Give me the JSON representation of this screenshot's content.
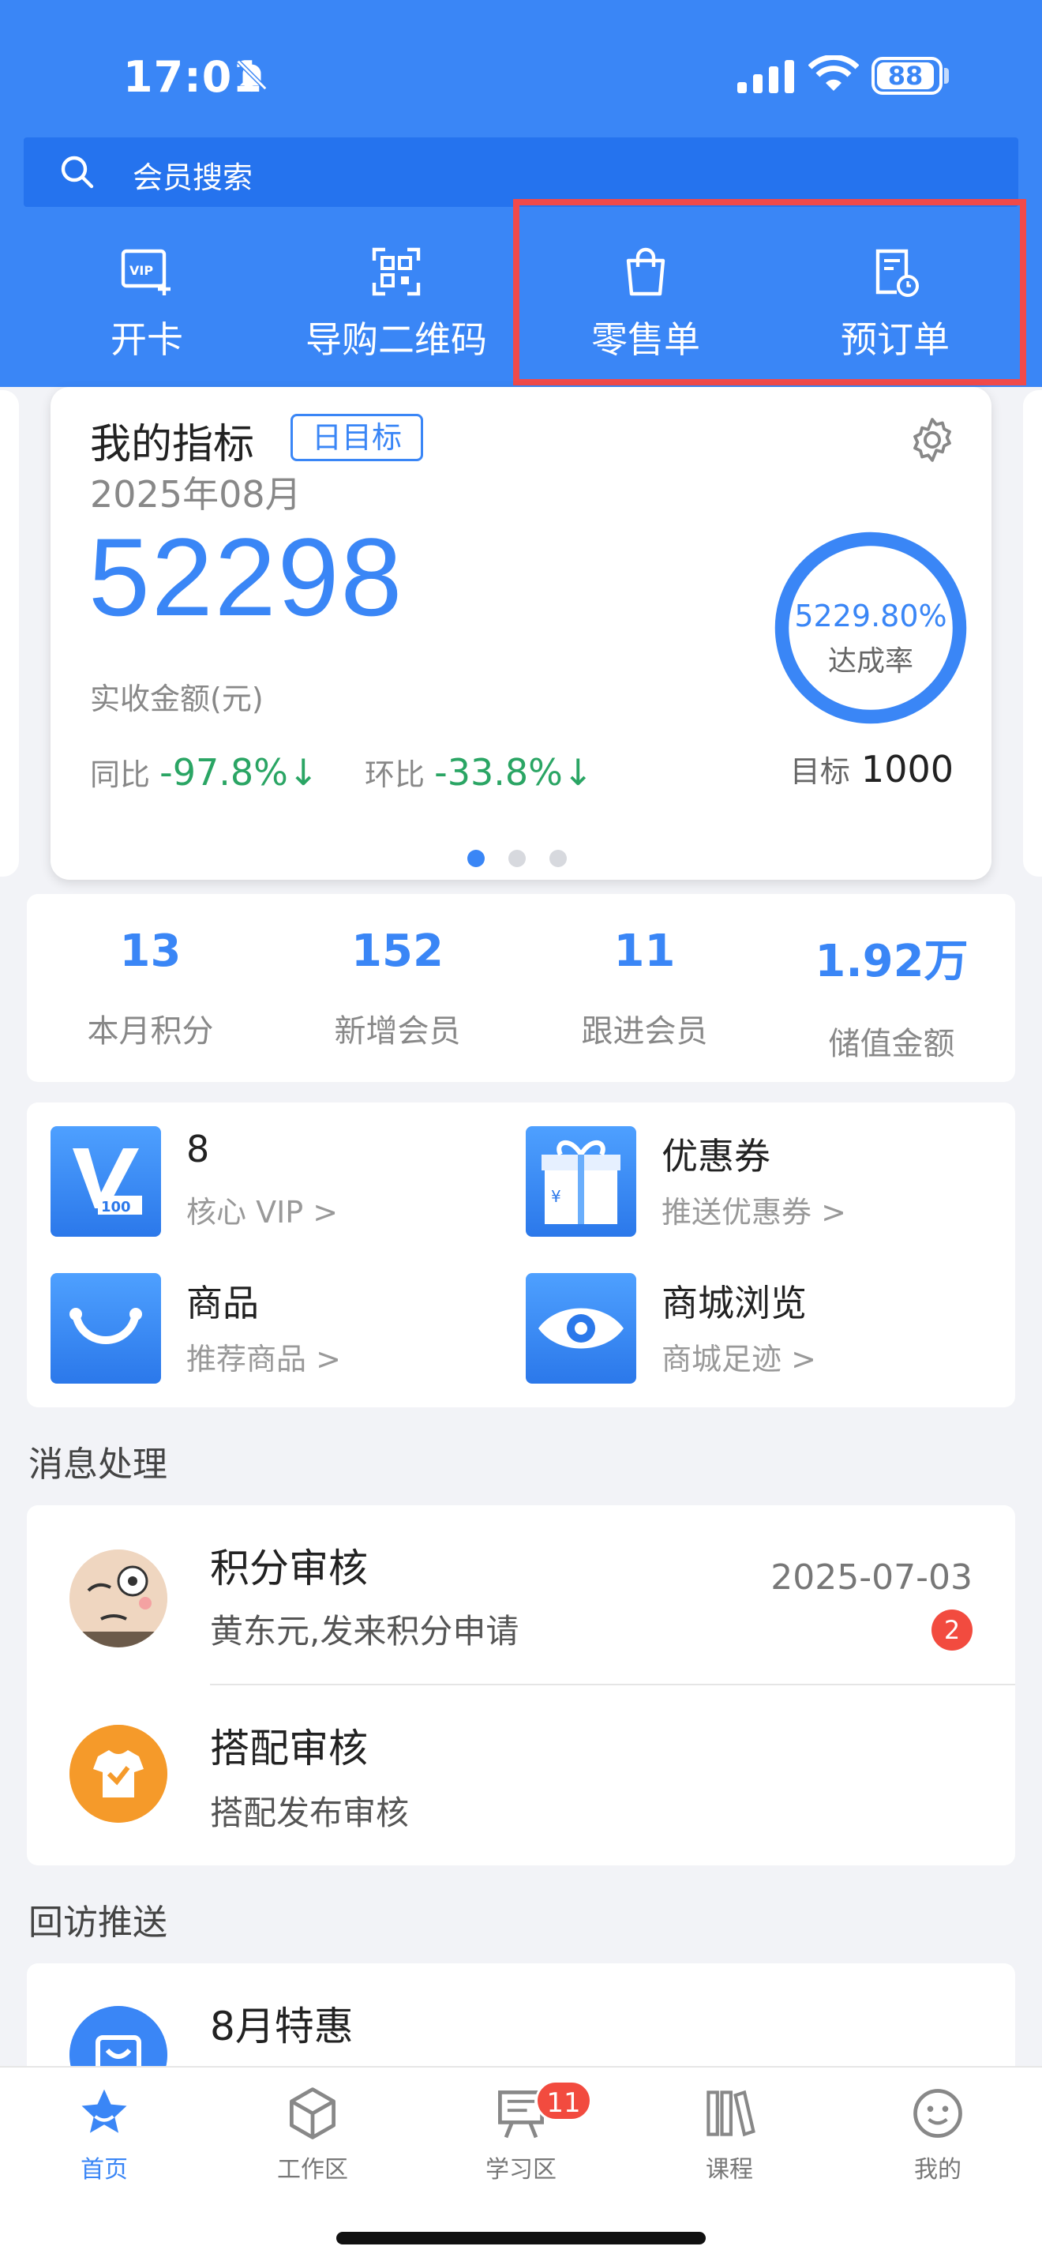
{
  "status_bar": {
    "time": "17:01",
    "battery": "88"
  },
  "search": {
    "placeholder": "会员搜索"
  },
  "quick_actions": [
    {
      "label": "开卡",
      "icon": "vip-card-icon"
    },
    {
      "label": "导购二维码",
      "icon": "qr-code-icon"
    },
    {
      "label": "零售单",
      "icon": "shopping-bag-icon"
    },
    {
      "label": "预订单",
      "icon": "clock-order-icon"
    }
  ],
  "metric": {
    "title": "我的指标",
    "badge": "日目标",
    "date": "2025年08月",
    "value": "52298",
    "value_label": "实收金额(元)",
    "yoy_label": "同比",
    "yoy_value": "-97.8%↓",
    "mom_label": "环比",
    "mom_value": "-33.8%↓",
    "rate": "5229.80%",
    "rate_label": "达成率",
    "target_label": "目标",
    "target_value": "1000",
    "page_count": 3,
    "active_page": 0
  },
  "stats": [
    {
      "value": "13",
      "label": "本月积分"
    },
    {
      "value": "152",
      "label": "新增会员"
    },
    {
      "value": "11",
      "label": "跟进会员"
    },
    {
      "value": "1.92万",
      "label": "储值金额"
    }
  ],
  "features": [
    {
      "title": "8",
      "subtitle": "核心 VIP >",
      "icon": "vip100-icon"
    },
    {
      "title": "优惠券",
      "subtitle": "推送优惠券 >",
      "icon": "gift-coupon-icon"
    },
    {
      "title": "商品",
      "subtitle": "推荐商品 >",
      "icon": "bag-smile-icon"
    },
    {
      "title": "商城浏览",
      "subtitle": "商城足迹 >",
      "icon": "eye-icon"
    }
  ],
  "messages_section": {
    "title": "消息处理"
  },
  "messages": [
    {
      "title": "积分审核",
      "subtitle": "黄东元,发来积分申请",
      "date": "2025-07-03",
      "badge": "2"
    },
    {
      "title": "搭配审核",
      "subtitle": "搭配发布审核"
    }
  ],
  "visit_section": {
    "title": "回访推送"
  },
  "visits": [
    {
      "title": "8月特惠"
    }
  ],
  "tabs": [
    {
      "label": "首页",
      "icon": "star-home-icon",
      "active": true
    },
    {
      "label": "工作区",
      "icon": "cube-icon"
    },
    {
      "label": "学习区",
      "icon": "board-icon",
      "badge": "11"
    },
    {
      "label": "课程",
      "icon": "books-icon"
    },
    {
      "label": "我的",
      "icon": "smile-icon"
    }
  ],
  "colors": {
    "primary": "#3a86f6",
    "search_bg": "#2573ee",
    "highlight": "#f04a4a",
    "positive": "#2aa564",
    "badge": "#f24b3f"
  }
}
